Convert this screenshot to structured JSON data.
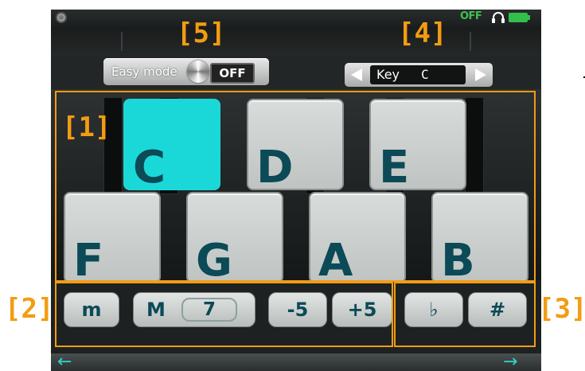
{
  "status_bar": {
    "audio_status": "OFF",
    "icons": [
      "disc-icon",
      "headphone-icon",
      "battery-icon"
    ],
    "status_color": "#3fc04f"
  },
  "easy_mode": {
    "label": "Easy mode",
    "value": "OFF"
  },
  "key_selector": {
    "label": "Key",
    "value": "C"
  },
  "notes": [
    {
      "label": "C",
      "selected": true
    },
    {
      "label": "D",
      "selected": false
    },
    {
      "label": "E",
      "selected": false
    },
    {
      "label": "F",
      "selected": false
    },
    {
      "label": "G",
      "selected": false
    },
    {
      "label": "A",
      "selected": false
    },
    {
      "label": "B",
      "selected": false
    }
  ],
  "modifiers": {
    "minor": "m",
    "major_letter": "M",
    "seventh": "7",
    "flat_five": "-5",
    "sharp_five": "+5",
    "flat": "♭",
    "sharp": "#"
  },
  "navigation": {
    "back_icon": "←",
    "forward_icon": "→"
  },
  "callouts": {
    "c1": "[1]",
    "c2": "[2]",
    "c3": "[3]",
    "c4": "[4]",
    "c5": "[5]"
  },
  "colors": {
    "accent": "#f39c12",
    "selected_key": "#1bd8d8",
    "key_text": "#0b4a56",
    "nav_arrows": "#34d4c8"
  }
}
